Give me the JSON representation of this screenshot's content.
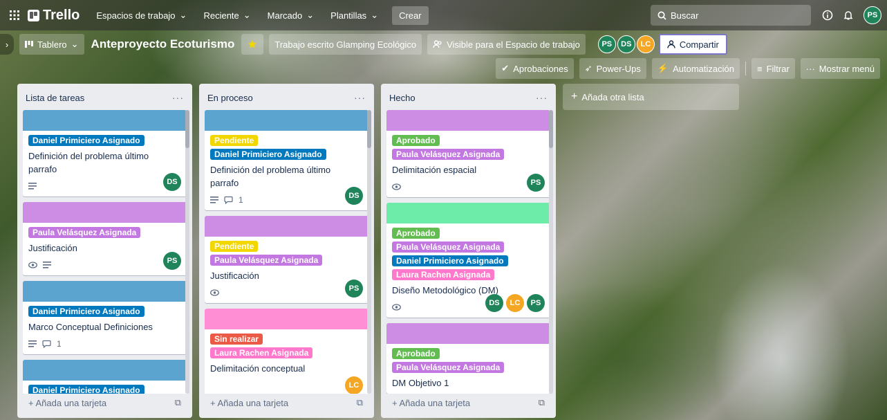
{
  "topbar": {
    "brand": "Trello",
    "nav": [
      "Espacios de trabajo",
      "Reciente",
      "Marcado",
      "Plantillas"
    ],
    "create_label": "Crear",
    "search_label": "Buscar",
    "user_initials": "PS"
  },
  "board": {
    "view_label": "Tablero",
    "title": "Anteproyecto Ecoturismo",
    "workspace": "Trabajo escrito Glamping Ecológico",
    "visibility": "Visible para el Espacio de trabajo",
    "members": [
      "PS",
      "DS",
      "LC"
    ],
    "share_label": "Compartir",
    "toolbar": [
      "Aprobaciones",
      "Power-Ups",
      "Automatización",
      "Filtrar",
      "Mostrar menú"
    ]
  },
  "colors": {
    "blue_cover": "#5ba4cf",
    "purple_cover": "#cd8de5",
    "green_cover": "#6deca9",
    "pink_cover": "#ff8ed4",
    "label_blue": "#0079bf",
    "label_purple": "#c377e0",
    "label_pink": "#ff78cb",
    "label_green": "#61bd4f",
    "label_yellow": "#f2d600",
    "label_red": "#eb5a46",
    "avatar_ps": "#1f845a",
    "avatar_ds": "#1f845a",
    "avatar_lc": "#f5a623"
  },
  "lists": [
    {
      "name": "Lista de tareas",
      "add_label": "Añada una tarjeta",
      "cards": [
        {
          "cover": "blue",
          "labels": [
            {
              "text": "Daniel Primiciero Asignado",
              "color": "blue"
            }
          ],
          "title": "Definición del problema último parrafo",
          "badges": [
            "desc"
          ],
          "comments": "",
          "members": [
            "DS"
          ]
        },
        {
          "cover": "purple",
          "labels": [
            {
              "text": "Paula Velásquez Asignada",
              "color": "purple"
            }
          ],
          "title": "Justificación",
          "badges": [
            "watch",
            "desc"
          ],
          "comments": "",
          "members": [
            "PS"
          ]
        },
        {
          "cover": "blue",
          "labels": [
            {
              "text": "Daniel Primiciero Asignado",
              "color": "blue"
            }
          ],
          "title": "Marco Conceptual Definiciones",
          "badges": [
            "desc",
            "comment"
          ],
          "comments": "1",
          "members": []
        },
        {
          "cover": "blue",
          "labels": [
            {
              "text": "Daniel Primiciero Asignado",
              "color": "blue"
            }
          ],
          "title": "",
          "badges": [],
          "comments": "",
          "members": []
        }
      ]
    },
    {
      "name": "En proceso",
      "add_label": "Añada una tarjeta",
      "cards": [
        {
          "cover": "blue",
          "labels": [
            {
              "text": "Pendiente",
              "color": "yellow"
            },
            {
              "text": "Daniel Primiciero Asignado",
              "color": "blue"
            }
          ],
          "title": "Definición del problema último parrafo",
          "badges": [
            "desc",
            "comment"
          ],
          "comments": "1",
          "members": [
            "DS"
          ]
        },
        {
          "cover": "purple",
          "labels": [
            {
              "text": "Pendiente",
              "color": "yellow"
            },
            {
              "text": "Paula Velásquez Asignada",
              "color": "purple"
            }
          ],
          "title": "Justificación",
          "badges": [
            "watch"
          ],
          "comments": "",
          "members": [
            "PS"
          ]
        },
        {
          "cover": "pink",
          "labels": [
            {
              "text": "Sin realizar",
              "color": "red"
            },
            {
              "text": "Laura Rachen Asignada",
              "color": "pink"
            }
          ],
          "title": "Delimitación conceptual",
          "badges": [],
          "comments": "",
          "members": [
            "LC"
          ]
        }
      ]
    },
    {
      "name": "Hecho",
      "add_label": "Añada una tarjeta",
      "cards": [
        {
          "cover": "purple",
          "labels": [
            {
              "text": "Aprobado",
              "color": "green"
            },
            {
              "text": "Paula Velásquez Asignada",
              "color": "purple"
            }
          ],
          "title": "Delimitación espacial",
          "badges": [
            "watch"
          ],
          "comments": "",
          "members": [
            "PS"
          ]
        },
        {
          "cover": "green",
          "labels": [
            {
              "text": "Aprobado",
              "color": "green"
            },
            {
              "text": "Paula Velásquez Asignada",
              "color": "purple"
            },
            {
              "text": "Daniel Primiciero Asignado",
              "color": "blue"
            },
            {
              "text": "Laura Rachen Asignada",
              "color": "pink"
            }
          ],
          "title": "Diseño Metodológico (DM)",
          "badges": [
            "watch"
          ],
          "comments": "",
          "members": [
            "DS",
            "LC",
            "PS"
          ]
        },
        {
          "cover": "purple",
          "labels": [
            {
              "text": "Aprobado",
              "color": "green"
            },
            {
              "text": "Paula Velásquez Asignada",
              "color": "purple"
            }
          ],
          "title": "DM Objetivo 1",
          "badges": [],
          "comments": "",
          "members": []
        }
      ]
    }
  ],
  "add_list_label": "Añada otra lista"
}
